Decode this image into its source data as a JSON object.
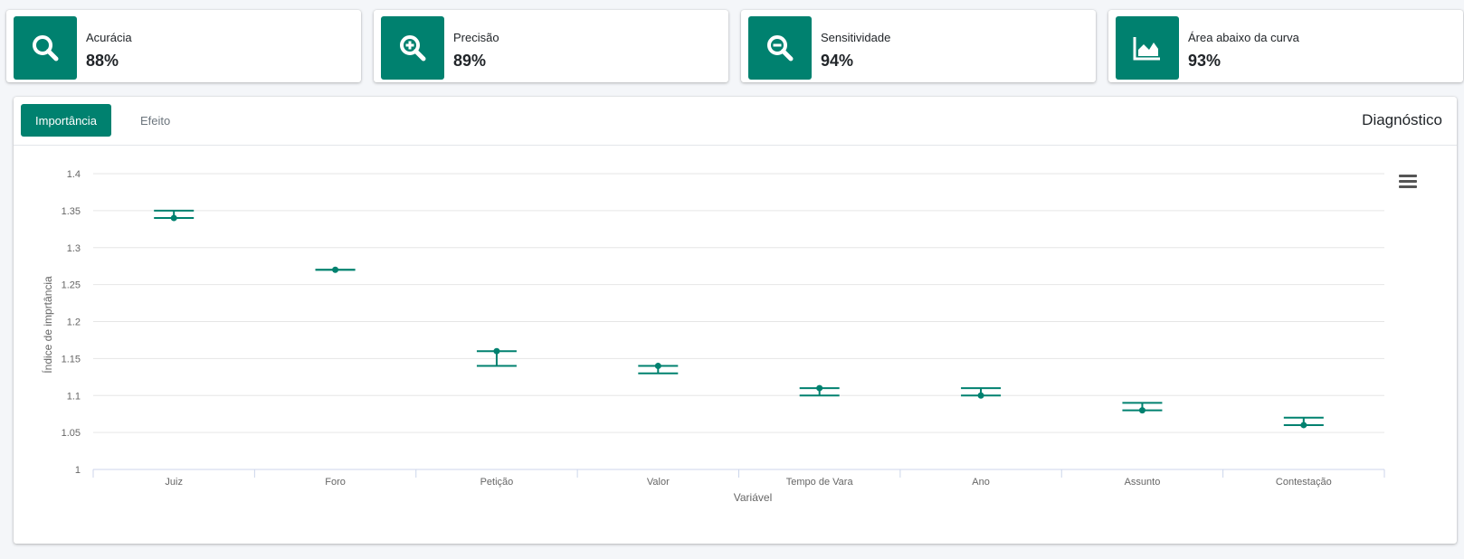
{
  "kpis": [
    {
      "label": "Acurácia",
      "value": "88%",
      "icon": "search-icon"
    },
    {
      "label": "Precisão",
      "value": "89%",
      "icon": "zoom-in-icon"
    },
    {
      "label": "Sensitividade",
      "value": "94%",
      "icon": "zoom-out-icon"
    },
    {
      "label": "Área abaixo da curva",
      "value": "93%",
      "icon": "area-chart-icon"
    }
  ],
  "tabs": [
    {
      "label": "Importância",
      "active": true
    },
    {
      "label": "Efeito",
      "active": false
    }
  ],
  "card_title": "Diagnóstico",
  "colors": {
    "accent": "#00816f",
    "series": "#00816f"
  },
  "chart_data": {
    "type": "scatter",
    "xlabel": "Variável",
    "ylabel": "Índice de imprtância",
    "ylim": [
      1,
      1.4
    ],
    "yticks": [
      "1",
      "1.05",
      "1.1",
      "1.15",
      "1.2",
      "1.25",
      "1.3",
      "1.35",
      "1.4"
    ],
    "categories": [
      "Juiz",
      "Foro",
      "Petição",
      "Valor",
      "Tempo de Vara",
      "Ano",
      "Assunto",
      "Contestação"
    ],
    "values": [
      1.34,
      1.27,
      1.16,
      1.14,
      1.11,
      1.1,
      1.08,
      1.06
    ],
    "error_low": [
      1.34,
      1.27,
      1.14,
      1.13,
      1.1,
      1.1,
      1.08,
      1.06
    ],
    "error_high": [
      1.35,
      1.27,
      1.16,
      1.14,
      1.11,
      1.11,
      1.09,
      1.07
    ],
    "grid": true
  }
}
